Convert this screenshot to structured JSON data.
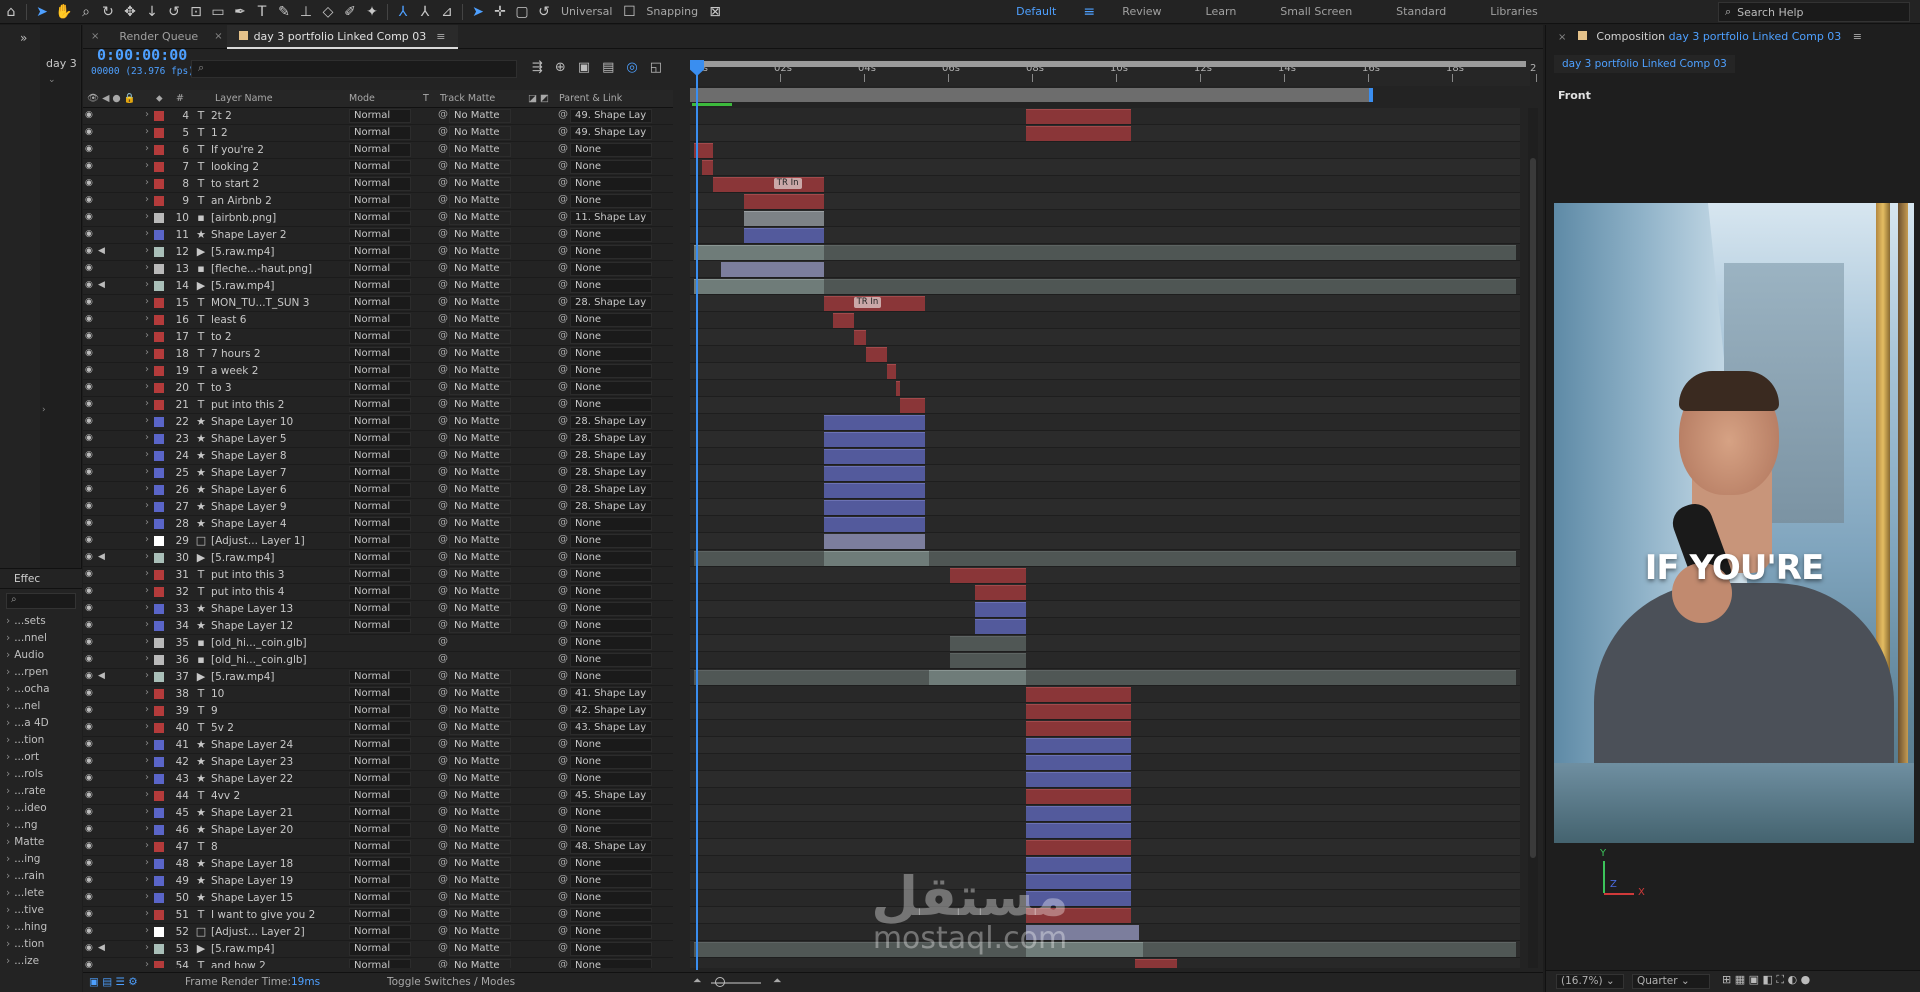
{
  "toolbar": {
    "universal_label": "Universal",
    "snapping_label": "Snapping",
    "workspaces": [
      "Default",
      "Review",
      "Learn",
      "Small Screen",
      "Standard",
      "Libraries"
    ],
    "active_workspace": "Default",
    "search_placeholder": "Search Help"
  },
  "left_panel": {
    "project_label": "day 3",
    "effects_tab": "Effec",
    "effects_items": [
      "...sets",
      "...nnel",
      "Audio",
      "...rpen",
      "...ocha",
      "...nel",
      "...a 4D",
      "...tion",
      "...ort",
      "...rols",
      "...rate",
      "...ideo",
      "...ng",
      "Matte",
      "...ing",
      "...rain",
      "...lete",
      "...tive",
      "...hing",
      "...tion",
      "...ize"
    ]
  },
  "timeline": {
    "tabs": [
      {
        "label": "Render Queue"
      },
      {
        "label": "day 3 portfolio Linked Comp 03"
      }
    ],
    "timecode": "0:00:00:00",
    "fps": "00000 (23.976 fps)",
    "search_placeholder": "",
    "columns": {
      "layer_name": "Layer Name",
      "mode": "Mode",
      "t": "T",
      "track_matte": "Track Matte",
      "parent": "Parent & Link"
    },
    "ruler": [
      "00s",
      "02s",
      "04s",
      "06s",
      "08s",
      "10s",
      "12s",
      "14s",
      "16s",
      "18s",
      "2"
    ],
    "status": {
      "frame_render_label": "Frame Render Time:",
      "frame_render_value": "19ms",
      "toggle_label": "Toggle Switches / Modes"
    },
    "tr_in_label": "TR In",
    "layers": [
      {
        "num": "4",
        "type": "T",
        "name": "2t 2",
        "mode": "Normal",
        "matte": "No Matte",
        "parent": "49. Shape Lay",
        "color": "#b43b3b",
        "kind": "red",
        "start": 7.9,
        "end": 10.4,
        "eye": true,
        "audio": false
      },
      {
        "num": "5",
        "type": "T",
        "name": "1 2",
        "mode": "Normal",
        "matte": "No Matte",
        "parent": "49. Shape Lay",
        "color": "#b43b3b",
        "kind": "red",
        "start": 7.9,
        "end": 10.4,
        "eye": true,
        "audio": false
      },
      {
        "num": "6",
        "type": "T",
        "name": "If you're 2",
        "mode": "Normal",
        "matte": "No Matte",
        "parent": "None",
        "color": "#b43b3b",
        "kind": "red",
        "start": 0.0,
        "end": 0.45,
        "eye": true,
        "audio": false
      },
      {
        "num": "7",
        "type": "T",
        "name": "looking 2",
        "mode": "Normal",
        "matte": "No Matte",
        "parent": "None",
        "color": "#b43b3b",
        "kind": "red",
        "start": 0.2,
        "end": 0.45,
        "eye": true,
        "audio": false
      },
      {
        "num": "8",
        "type": "T",
        "name": "to start 2",
        "mode": "Normal",
        "matte": "No Matte",
        "parent": "None",
        "color": "#b43b3b",
        "kind": "red",
        "start": 0.45,
        "end": 3.1,
        "eye": true,
        "audio": false,
        "tr": true,
        "tr_pos": 1.9
      },
      {
        "num": "9",
        "type": "T",
        "name": "an Airbnb 2",
        "mode": "Normal",
        "matte": "No Matte",
        "parent": "None",
        "color": "#b43b3b",
        "kind": "red",
        "start": 1.2,
        "end": 3.1,
        "eye": true,
        "audio": false
      },
      {
        "num": "10",
        "type": "F",
        "name": "[airbnb.png]",
        "mode": "Normal",
        "matte": "No Matte",
        "parent": "11. Shape Lay",
        "color": "#b9b9b9",
        "kind": "gray",
        "start": 1.2,
        "end": 3.1,
        "eye": true,
        "audio": false
      },
      {
        "num": "11",
        "type": "S",
        "name": "Shape Layer 2",
        "mode": "Normal",
        "matte": "No Matte",
        "parent": "None",
        "color": "#5a65c8",
        "kind": "blue",
        "start": 1.2,
        "end": 3.1,
        "eye": true,
        "audio": false
      },
      {
        "num": "12",
        "type": "V",
        "name": "[5.raw.mp4]",
        "mode": "Normal",
        "matte": "No Matte",
        "parent": "None",
        "color": "#a9bfb8",
        "kind": "sage",
        "start": 0.0,
        "end": 20.0,
        "eye": true,
        "audio": true,
        "lite": 3.1
      },
      {
        "num": "13",
        "type": "F",
        "name": "[fleche...-haut.png]",
        "mode": "Normal",
        "matte": "No Matte",
        "parent": "None",
        "color": "#b9b9b9",
        "kind": "lav",
        "start": 0.65,
        "end": 3.1,
        "eye": true,
        "audio": false
      },
      {
        "num": "14",
        "type": "V",
        "name": "[5.raw.mp4]",
        "mode": "Normal",
        "matte": "No Matte",
        "parent": "None",
        "color": "#a9bfb8",
        "kind": "sage",
        "start": 0.0,
        "end": 20.0,
        "eye": true,
        "audio": true,
        "lite": 3.1
      },
      {
        "num": "15",
        "type": "T",
        "name": "MON_TU...T_SUN 3",
        "mode": "Normal",
        "matte": "No Matte",
        "parent": "28. Shape Lay",
        "color": "#b43b3b",
        "kind": "red",
        "start": 3.1,
        "end": 5.5,
        "eye": true,
        "audio": false,
        "tr": true,
        "tr_pos": 3.8
      },
      {
        "num": "16",
        "type": "T",
        "name": "least 6",
        "mode": "Normal",
        "matte": "No Matte",
        "parent": "None",
        "color": "#b43b3b",
        "kind": "red",
        "start": 3.3,
        "end": 3.8,
        "eye": true,
        "audio": false
      },
      {
        "num": "17",
        "type": "T",
        "name": "to 2",
        "mode": "Normal",
        "matte": "No Matte",
        "parent": "None",
        "color": "#b43b3b",
        "kind": "red",
        "start": 3.8,
        "end": 4.1,
        "eye": true,
        "audio": false
      },
      {
        "num": "18",
        "type": "T",
        "name": "7 hours 2",
        "mode": "Normal",
        "matte": "No Matte",
        "parent": "None",
        "color": "#b43b3b",
        "kind": "red",
        "start": 4.1,
        "end": 4.6,
        "eye": true,
        "audio": false
      },
      {
        "num": "19",
        "type": "T",
        "name": "a week 2",
        "mode": "Normal",
        "matte": "No Matte",
        "parent": "None",
        "color": "#b43b3b",
        "kind": "red",
        "start": 4.6,
        "end": 4.8,
        "eye": true,
        "audio": false
      },
      {
        "num": "20",
        "type": "T",
        "name": "to 3",
        "mode": "Normal",
        "matte": "No Matte",
        "parent": "None",
        "color": "#b43b3b",
        "kind": "red",
        "start": 4.8,
        "end": 4.9,
        "eye": true,
        "audio": false
      },
      {
        "num": "21",
        "type": "T",
        "name": "put into this 2",
        "mode": "Normal",
        "matte": "No Matte",
        "parent": "None",
        "color": "#b43b3b",
        "kind": "red",
        "start": 4.9,
        "end": 5.5,
        "eye": true,
        "audio": false
      },
      {
        "num": "22",
        "type": "S",
        "name": "Shape Layer 10",
        "mode": "Normal",
        "matte": "No Matte",
        "parent": "28. Shape Lay",
        "color": "#5a65c8",
        "kind": "blue",
        "start": 3.1,
        "end": 5.5,
        "eye": true,
        "audio": false
      },
      {
        "num": "23",
        "type": "S",
        "name": "Shape Layer 5",
        "mode": "Normal",
        "matte": "No Matte",
        "parent": "28. Shape Lay",
        "color": "#5a65c8",
        "kind": "blue",
        "start": 3.1,
        "end": 5.5,
        "eye": true,
        "audio": false
      },
      {
        "num": "24",
        "type": "S",
        "name": "Shape Layer 8",
        "mode": "Normal",
        "matte": "No Matte",
        "parent": "28. Shape Lay",
        "color": "#5a65c8",
        "kind": "blue",
        "start": 3.1,
        "end": 5.5,
        "eye": true,
        "audio": false
      },
      {
        "num": "25",
        "type": "S",
        "name": "Shape Layer 7",
        "mode": "Normal",
        "matte": "No Matte",
        "parent": "28. Shape Lay",
        "color": "#5a65c8",
        "kind": "blue",
        "start": 3.1,
        "end": 5.5,
        "eye": true,
        "audio": false
      },
      {
        "num": "26",
        "type": "S",
        "name": "Shape Layer 6",
        "mode": "Normal",
        "matte": "No Matte",
        "parent": "28. Shape Lay",
        "color": "#5a65c8",
        "kind": "blue",
        "start": 3.1,
        "end": 5.5,
        "eye": true,
        "audio": false
      },
      {
        "num": "27",
        "type": "S",
        "name": "Shape Layer 9",
        "mode": "Normal",
        "matte": "No Matte",
        "parent": "28. Shape Lay",
        "color": "#5a65c8",
        "kind": "blue",
        "start": 3.1,
        "end": 5.5,
        "eye": true,
        "audio": false
      },
      {
        "num": "28",
        "type": "S",
        "name": "Shape Layer 4",
        "mode": "Normal",
        "matte": "No Matte",
        "parent": "None",
        "color": "#5a65c8",
        "kind": "blue",
        "start": 3.1,
        "end": 5.5,
        "eye": true,
        "audio": false
      },
      {
        "num": "29",
        "type": "W",
        "name": "[Adjust... Layer 1]",
        "mode": "Normal",
        "matte": "No Matte",
        "parent": "None",
        "color": "#ffffff",
        "kind": "lav",
        "start": 3.1,
        "end": 5.5,
        "eye": true,
        "audio": false
      },
      {
        "num": "30",
        "type": "V",
        "name": "[5.raw.mp4]",
        "mode": "Normal",
        "matte": "No Matte",
        "parent": "None",
        "color": "#a9bfb8",
        "kind": "sage",
        "start": 0.0,
        "end": 20.0,
        "eye": true,
        "audio": true,
        "lite": 5.6,
        "lite_start": 3.1
      },
      {
        "num": "31",
        "type": "T",
        "name": "put into this 3",
        "mode": "Normal",
        "matte": "No Matte",
        "parent": "None",
        "color": "#b43b3b",
        "kind": "red",
        "start": 6.1,
        "end": 7.9,
        "eye": true,
        "audio": false
      },
      {
        "num": "32",
        "type": "T",
        "name": "put into this 4",
        "mode": "Normal",
        "matte": "No Matte",
        "parent": "None",
        "color": "#b43b3b",
        "kind": "red",
        "start": 6.7,
        "end": 7.9,
        "eye": true,
        "audio": false
      },
      {
        "num": "33",
        "type": "S",
        "name": "Shape Layer 13",
        "mode": "Normal",
        "matte": "No Matte",
        "parent": "None",
        "color": "#5a65c8",
        "kind": "blue",
        "start": 6.7,
        "end": 7.9,
        "eye": true,
        "audio": false
      },
      {
        "num": "34",
        "type": "S",
        "name": "Shape Layer 12",
        "mode": "Normal",
        "matte": "No Matte",
        "parent": "None",
        "color": "#5a65c8",
        "kind": "blue",
        "start": 6.7,
        "end": 7.9,
        "eye": true,
        "audio": false
      },
      {
        "num": "35",
        "type": "G",
        "name": "[old_hi..._coin.glb]",
        "mode": "",
        "matte": "",
        "parent": "None",
        "color": "#b9b9b9",
        "kind": "sage",
        "start": 6.1,
        "end": 7.9,
        "eye": true,
        "audio": false
      },
      {
        "num": "36",
        "type": "G",
        "name": "[old_hi..._coin.glb]",
        "mode": "",
        "matte": "",
        "parent": "None",
        "color": "#b9b9b9",
        "kind": "sage",
        "start": 6.1,
        "end": 7.9,
        "eye": true,
        "audio": false
      },
      {
        "num": "37",
        "type": "V",
        "name": "[5.raw.mp4]",
        "mode": "Normal",
        "matte": "No Matte",
        "parent": "None",
        "color": "#a9bfb8",
        "kind": "sage",
        "start": 0.0,
        "end": 20.0,
        "eye": true,
        "audio": true,
        "lite": 7.9,
        "lite_start": 5.6
      },
      {
        "num": "38",
        "type": "T",
        "name": "10",
        "mode": "Normal",
        "matte": "No Matte",
        "parent": "41. Shape Lay",
        "color": "#b43b3b",
        "kind": "red",
        "start": 7.9,
        "end": 10.4,
        "eye": true,
        "audio": false
      },
      {
        "num": "39",
        "type": "T",
        "name": "9",
        "mode": "Normal",
        "matte": "No Matte",
        "parent": "42. Shape Lay",
        "color": "#b43b3b",
        "kind": "red",
        "start": 7.9,
        "end": 10.4,
        "eye": true,
        "audio": false
      },
      {
        "num": "40",
        "type": "T",
        "name": "5v 2",
        "mode": "Normal",
        "matte": "No Matte",
        "parent": "43. Shape Lay",
        "color": "#b43b3b",
        "kind": "red",
        "start": 7.9,
        "end": 10.4,
        "eye": true,
        "audio": false
      },
      {
        "num": "41",
        "type": "S",
        "name": "Shape Layer 24",
        "mode": "Normal",
        "matte": "No Matte",
        "parent": "None",
        "color": "#5a65c8",
        "kind": "blue",
        "start": 7.9,
        "end": 10.4,
        "eye": true,
        "audio": false
      },
      {
        "num": "42",
        "type": "S",
        "name": "Shape Layer 23",
        "mode": "Normal",
        "matte": "No Matte",
        "parent": "None",
        "color": "#5a65c8",
        "kind": "blue",
        "start": 7.9,
        "end": 10.4,
        "eye": true,
        "audio": false
      },
      {
        "num": "43",
        "type": "S",
        "name": "Shape Layer 22",
        "mode": "Normal",
        "matte": "No Matte",
        "parent": "None",
        "color": "#5a65c8",
        "kind": "blue",
        "start": 7.9,
        "end": 10.4,
        "eye": true,
        "audio": false
      },
      {
        "num": "44",
        "type": "T",
        "name": "4vv 2",
        "mode": "Normal",
        "matte": "No Matte",
        "parent": "45. Shape Lay",
        "color": "#b43b3b",
        "kind": "red",
        "start": 7.9,
        "end": 10.4,
        "eye": true,
        "audio": false
      },
      {
        "num": "45",
        "type": "S",
        "name": "Shape Layer 21",
        "mode": "Normal",
        "matte": "No Matte",
        "parent": "None",
        "color": "#5a65c8",
        "kind": "blue",
        "start": 7.9,
        "end": 10.4,
        "eye": true,
        "audio": false
      },
      {
        "num": "46",
        "type": "S",
        "name": "Shape Layer 20",
        "mode": "Normal",
        "matte": "No Matte",
        "parent": "None",
        "color": "#5a65c8",
        "kind": "blue",
        "start": 7.9,
        "end": 10.4,
        "eye": true,
        "audio": false
      },
      {
        "num": "47",
        "type": "T",
        "name": "8",
        "mode": "Normal",
        "matte": "No Matte",
        "parent": "48. Shape Lay",
        "color": "#b43b3b",
        "kind": "red",
        "start": 7.9,
        "end": 10.4,
        "eye": true,
        "audio": false
      },
      {
        "num": "48",
        "type": "S",
        "name": "Shape Layer 18",
        "mode": "Normal",
        "matte": "No Matte",
        "parent": "None",
        "color": "#5a65c8",
        "kind": "blue",
        "start": 7.9,
        "end": 10.4,
        "eye": true,
        "audio": false
      },
      {
        "num": "49",
        "type": "S",
        "name": "Shape Layer 19",
        "mode": "Normal",
        "matte": "No Matte",
        "parent": "None",
        "color": "#5a65c8",
        "kind": "blue",
        "start": 7.9,
        "end": 10.4,
        "eye": true,
        "audio": false
      },
      {
        "num": "50",
        "type": "S",
        "name": "Shape Layer 15",
        "mode": "Normal",
        "matte": "No Matte",
        "parent": "None",
        "color": "#5a65c8",
        "kind": "blue",
        "start": 7.9,
        "end": 10.4,
        "eye": true,
        "audio": false
      },
      {
        "num": "51",
        "type": "T",
        "name": "I want to give you 2",
        "mode": "Normal",
        "matte": "No Matte",
        "parent": "None",
        "color": "#b43b3b",
        "kind": "red",
        "start": 7.9,
        "end": 10.4,
        "eye": true,
        "audio": false
      },
      {
        "num": "52",
        "type": "W",
        "name": "[Adjust... Layer 2]",
        "mode": "Normal",
        "matte": "No Matte",
        "parent": "None",
        "color": "#ffffff",
        "kind": "lav",
        "start": 7.9,
        "end": 10.6,
        "eye": true,
        "audio": false
      },
      {
        "num": "53",
        "type": "V",
        "name": "[5.raw.mp4]",
        "mode": "Normal",
        "matte": "No Matte",
        "parent": "None",
        "color": "#a9bfb8",
        "kind": "sage",
        "start": 0.0,
        "end": 20.0,
        "eye": true,
        "audio": true,
        "lite": 10.7,
        "lite_start": 7.9
      },
      {
        "num": "54",
        "type": "T",
        "name": "and how 2",
        "mode": "Normal",
        "matte": "No Matte",
        "parent": "None",
        "color": "#b43b3b",
        "kind": "red",
        "start": 10.5,
        "end": 11.5,
        "eye": true,
        "audio": false
      }
    ]
  },
  "composition": {
    "tab_prefix": "Composition",
    "tab_comp": "day 3 portfolio Linked Comp 03",
    "sub_tab": "day 3 portfolio Linked Comp 03",
    "view_label": "Front",
    "caption": "IF YOU'RE",
    "zoom": "(16.7%)",
    "resolution": "Quarter",
    "axis_y": "Y",
    "axis_z": "Z",
    "axis_x": "X"
  },
  "watermark": {
    "arabic": "مستقل",
    "latin": "mostaql.com"
  }
}
